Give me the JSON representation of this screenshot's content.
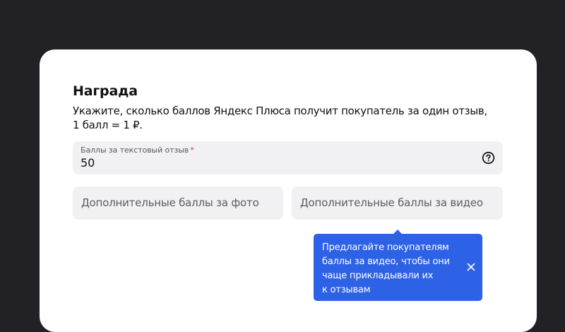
{
  "reward": {
    "title": "Награда",
    "description_line1": "Укажите, сколько баллов Яндекс Плюса получит покупатель за один отзыв,",
    "description_line2": "1 балл = 1 ₽."
  },
  "text_review_field": {
    "label": "Баллы за текстовый отзыв",
    "required_mark": "*",
    "value": "50",
    "icon": "question-circle-icon"
  },
  "photo_field": {
    "placeholder": "Дополнительные баллы за фото"
  },
  "video_field": {
    "placeholder": "Дополнительные баллы за видео"
  },
  "tooltip": {
    "lines": [
      "Предлагайте покупателям",
      "баллы за видео, чтобы они",
      "чаще прикладывали их",
      "к отзывам"
    ],
    "close_icon": "close-icon"
  },
  "colors": {
    "backdrop": "#222226",
    "field_bg": "#f1f1f3",
    "tooltip_bg": "#2d62e6",
    "required": "#e0314b"
  }
}
